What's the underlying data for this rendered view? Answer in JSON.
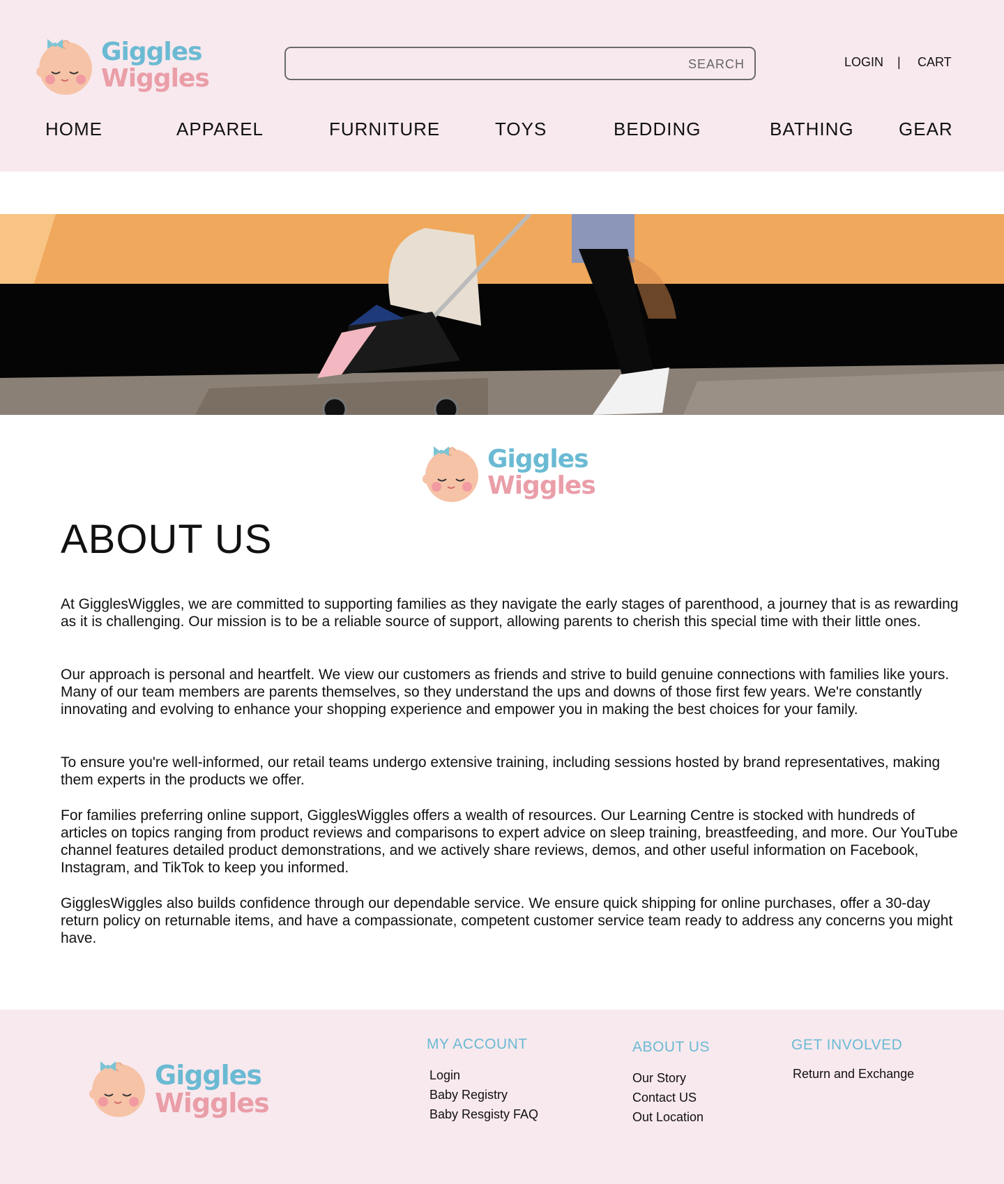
{
  "brand": {
    "line1": "Giggles",
    "line2": "Wiggles"
  },
  "search": {
    "label": "SEARCH"
  },
  "account": {
    "login": "LOGIN",
    "separator": "|",
    "cart": "CART"
  },
  "nav": [
    "HOME",
    "APPAREL",
    "FURNITURE",
    "TOYS",
    "BEDDING",
    "BATHING",
    "GEAR"
  ],
  "about": {
    "title": "ABOUT US",
    "paragraphs": [
      "At GigglesWiggles, we are committed to supporting families as they navigate the early stages of parenthood, a journey that is as rewarding as it is challenging. Our mission is to be a reliable source of support, allowing parents to cherish this special time with their little ones.",
      "Our approach is personal and heartfelt. We view our customers as friends and strive to build genuine connections with families like yours. Many of our team members are parents themselves, so they understand the ups and downs of those first few years. We're constantly innovating and evolving to enhance your shopping experience and empower you in making the best choices for your family.",
      "To ensure you're well-informed, our retail teams undergo extensive training, including sessions hosted by brand representatives, making them experts in the products we offer.",
      "For families preferring online support, GigglesWiggles offers a wealth of resources. Our Learning Centre is stocked with hundreds of articles on topics ranging from product reviews and comparisons to expert advice on sleep training, breastfeeding, and more. Our YouTube channel features detailed product demonstrations, and we actively share reviews, demos, and other useful information on Facebook, Instagram, and TikTok to keep you informed.",
      "GigglesWiggles also builds confidence through our dependable service. We ensure quick shipping for online purchases, offer a 30-day return policy on returnable items, and have a compassionate, competent customer service team ready to address any concerns you might have."
    ]
  },
  "footer": {
    "my_account": {
      "heading": "MY ACCOUNT",
      "links": [
        "Login",
        "Baby Registry",
        "Baby Resgisty FAQ"
      ]
    },
    "about_us": {
      "heading": "ABOUT US",
      "links": [
        "Our Story",
        "Contact US",
        "Out Location"
      ]
    },
    "get_involved": {
      "heading": "GET INVOLVED",
      "links": [
        "Return and Exchange"
      ]
    }
  },
  "colors": {
    "header_bg": "#f8e9ee",
    "brand_blue": "#6bbad3",
    "brand_pink": "#ea9ea8",
    "hero_wall": "#f0a85c"
  }
}
